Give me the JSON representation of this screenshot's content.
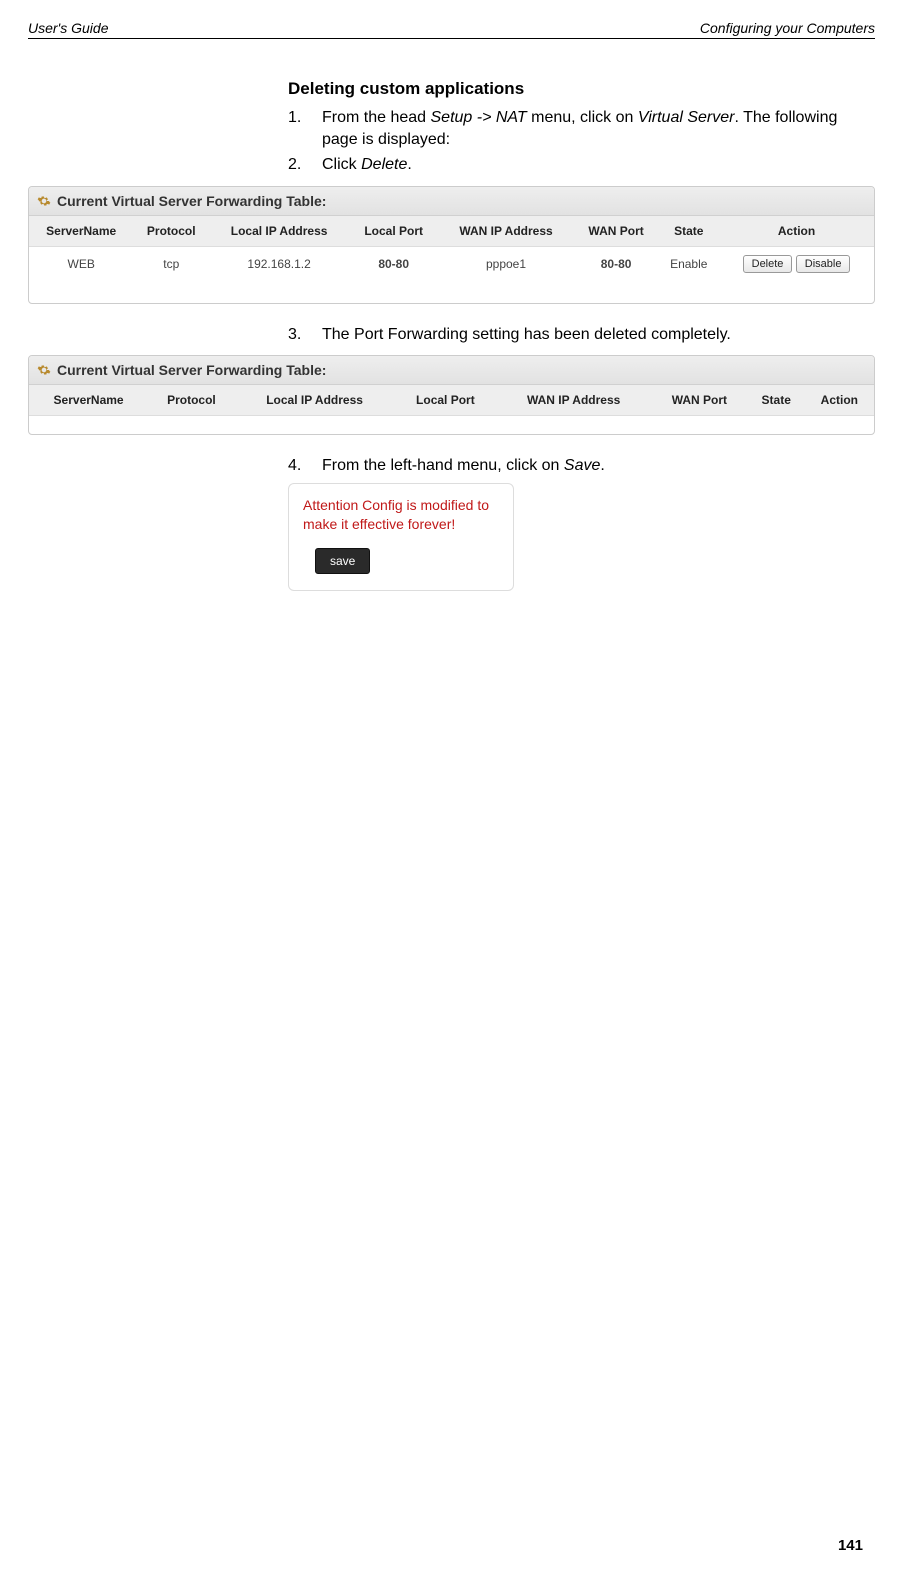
{
  "header": {
    "left": "User's Guide",
    "right": "Configuring your Computers"
  },
  "section": {
    "title": "Deleting custom applications",
    "steps": [
      {
        "num": "1.",
        "html": "From the head <em>Setup -> NAT</em> menu, click on <em>Virtual Server</em>. The following page is displayed:"
      },
      {
        "num": "2.",
        "html": "Click <em>Delete</em>."
      }
    ],
    "steps2": [
      {
        "num": "3.",
        "html": "The Port Forwarding setting has been deleted completely."
      }
    ],
    "steps3": [
      {
        "num": "4.",
        "html": "From the left-hand menu, click on <em>Save</em>."
      }
    ]
  },
  "table1": {
    "title": "Current Virtual Server Forwarding Table:",
    "headers": [
      "ServerName",
      "Protocol",
      "Local IP Address",
      "Local Port",
      "WAN IP Address",
      "WAN Port",
      "State",
      "Action"
    ],
    "rows": [
      {
        "ServerName": "WEB",
        "Protocol": "tcp",
        "LocalIP": "192.168.1.2",
        "LocalPort": "80-80",
        "WANIP": "pppoe1",
        "WANPort": "80-80",
        "State": "Enable",
        "btnDelete": "Delete",
        "btnDisable": "Disable"
      }
    ]
  },
  "table2": {
    "title": "Current Virtual Server Forwarding Table:",
    "headers": [
      "ServerName",
      "Protocol",
      "Local IP Address",
      "Local Port",
      "WAN IP Address",
      "WAN Port",
      "State",
      "Action"
    ]
  },
  "saveCard": {
    "text": "Attention Config is modified to make it effective forever!",
    "button": "save"
  },
  "pageNumber": "141"
}
